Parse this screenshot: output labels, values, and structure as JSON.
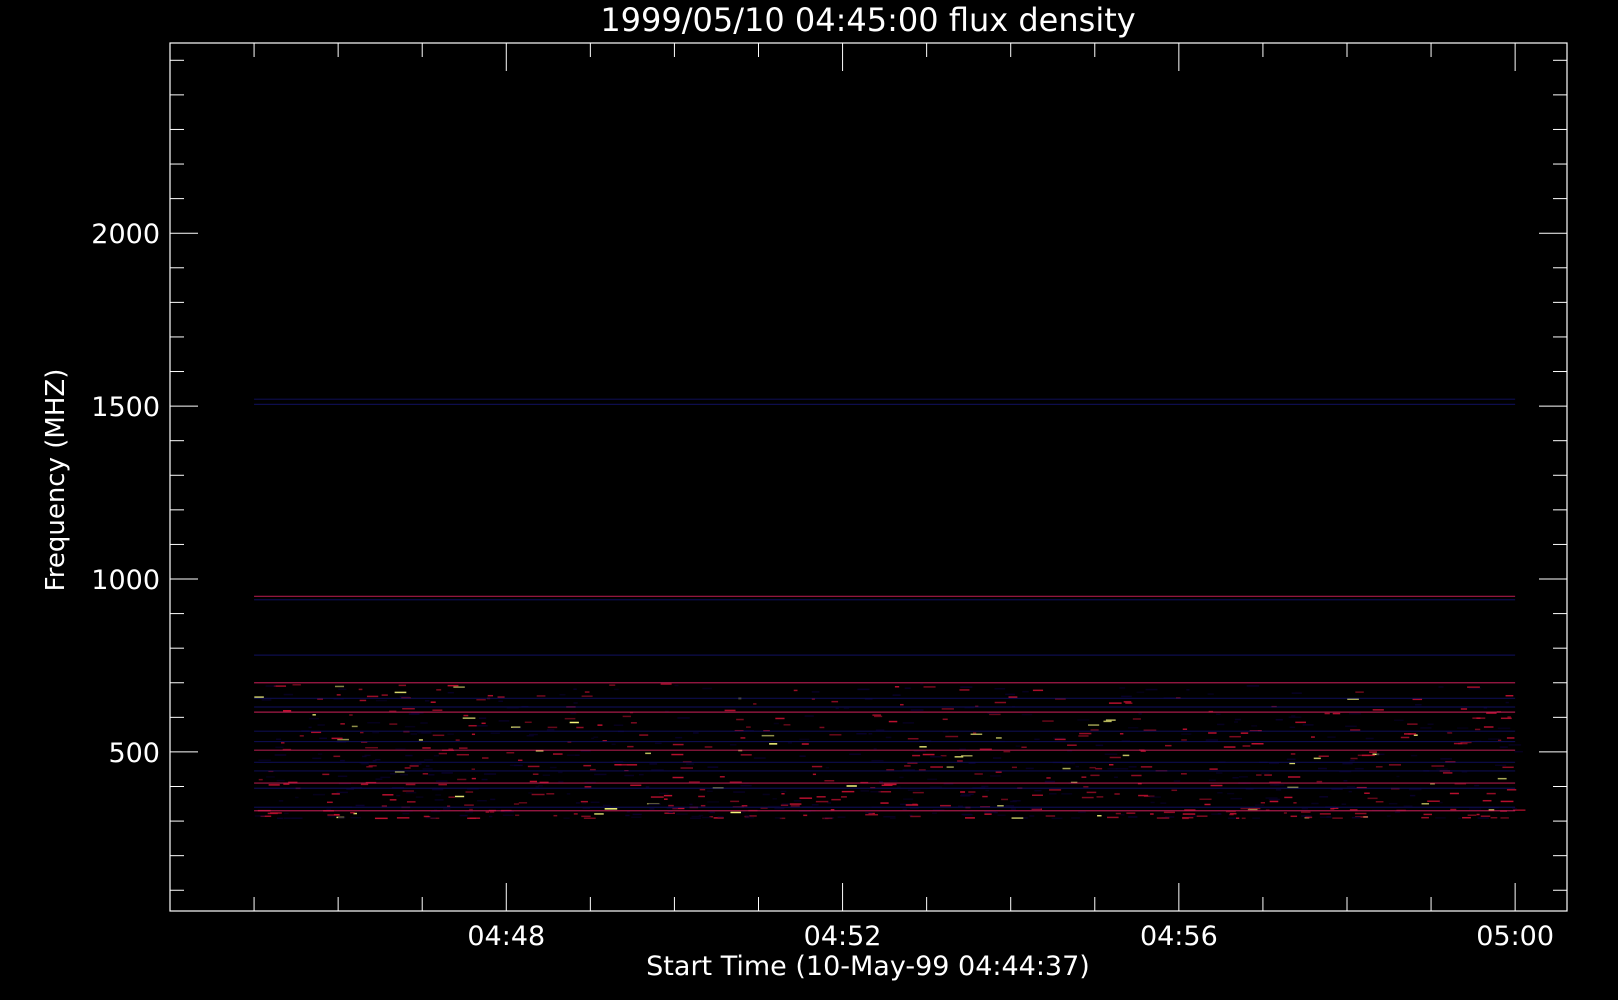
{
  "chart_data": {
    "type": "heatmap",
    "title": "1999/05/10 04:45:00 flux density",
    "xlabel": "Start Time (10-May-99 04:44:37)",
    "ylabel": "Frequency (MHZ)",
    "x_ticks": [
      "04:48",
      "04:52",
      "04:56",
      "05:00"
    ],
    "x_tick_minutes": [
      3.383,
      7.383,
      11.383,
      15.383
    ],
    "x_minor_step_min": 1,
    "xlim_minutes": [
      -0.617,
      16.0
    ],
    "data_time_range_minutes": [
      0.383,
      15.383
    ],
    "y_ticks": [
      500,
      1000,
      1500,
      2000
    ],
    "y_minor_step": 100,
    "ylim": [
      2550,
      40
    ],
    "data_freq_range": [
      100,
      2460
    ],
    "dense_rfi_band": [
      310,
      700
    ],
    "lower_data_cutoff_freq": 2110,
    "rfi_lines": [
      330,
      340,
      395,
      410,
      445,
      470,
      505,
      530,
      560,
      615,
      630,
      655,
      700,
      780,
      940,
      950,
      1505,
      1520
    ],
    "burst_columns_minutes": [
      1.0,
      1.6,
      2.6,
      3.1,
      4.4,
      5.3,
      6.3,
      7.1,
      8.5,
      9.8,
      10.4,
      12.4,
      13.8,
      14.7
    ],
    "colormap": {
      "low": "#000020",
      "mid": "#0000ff",
      "high": "#ff2020",
      "background": "#3600cc",
      "hot": "#ffff80"
    },
    "intensity_profile_time": [
      {
        "t": 0.383,
        "r": 10,
        "g": 0,
        "b": 70
      },
      {
        "t": 2.0,
        "r": 8,
        "g": 0,
        "b": 110
      },
      {
        "t": 4.0,
        "r": 5,
        "g": 0,
        "b": 170
      },
      {
        "t": 5.8,
        "r": 0,
        "g": 0,
        "b": 250
      },
      {
        "t": 6.2,
        "r": 10,
        "g": 10,
        "b": 255
      },
      {
        "t": 7.0,
        "r": 50,
        "g": 0,
        "b": 230
      },
      {
        "t": 9.0,
        "r": 80,
        "g": 0,
        "b": 190
      },
      {
        "t": 12.0,
        "r": 90,
        "g": 0,
        "b": 170
      },
      {
        "t": 15.383,
        "r": 85,
        "g": 0,
        "b": 175
      }
    ]
  }
}
